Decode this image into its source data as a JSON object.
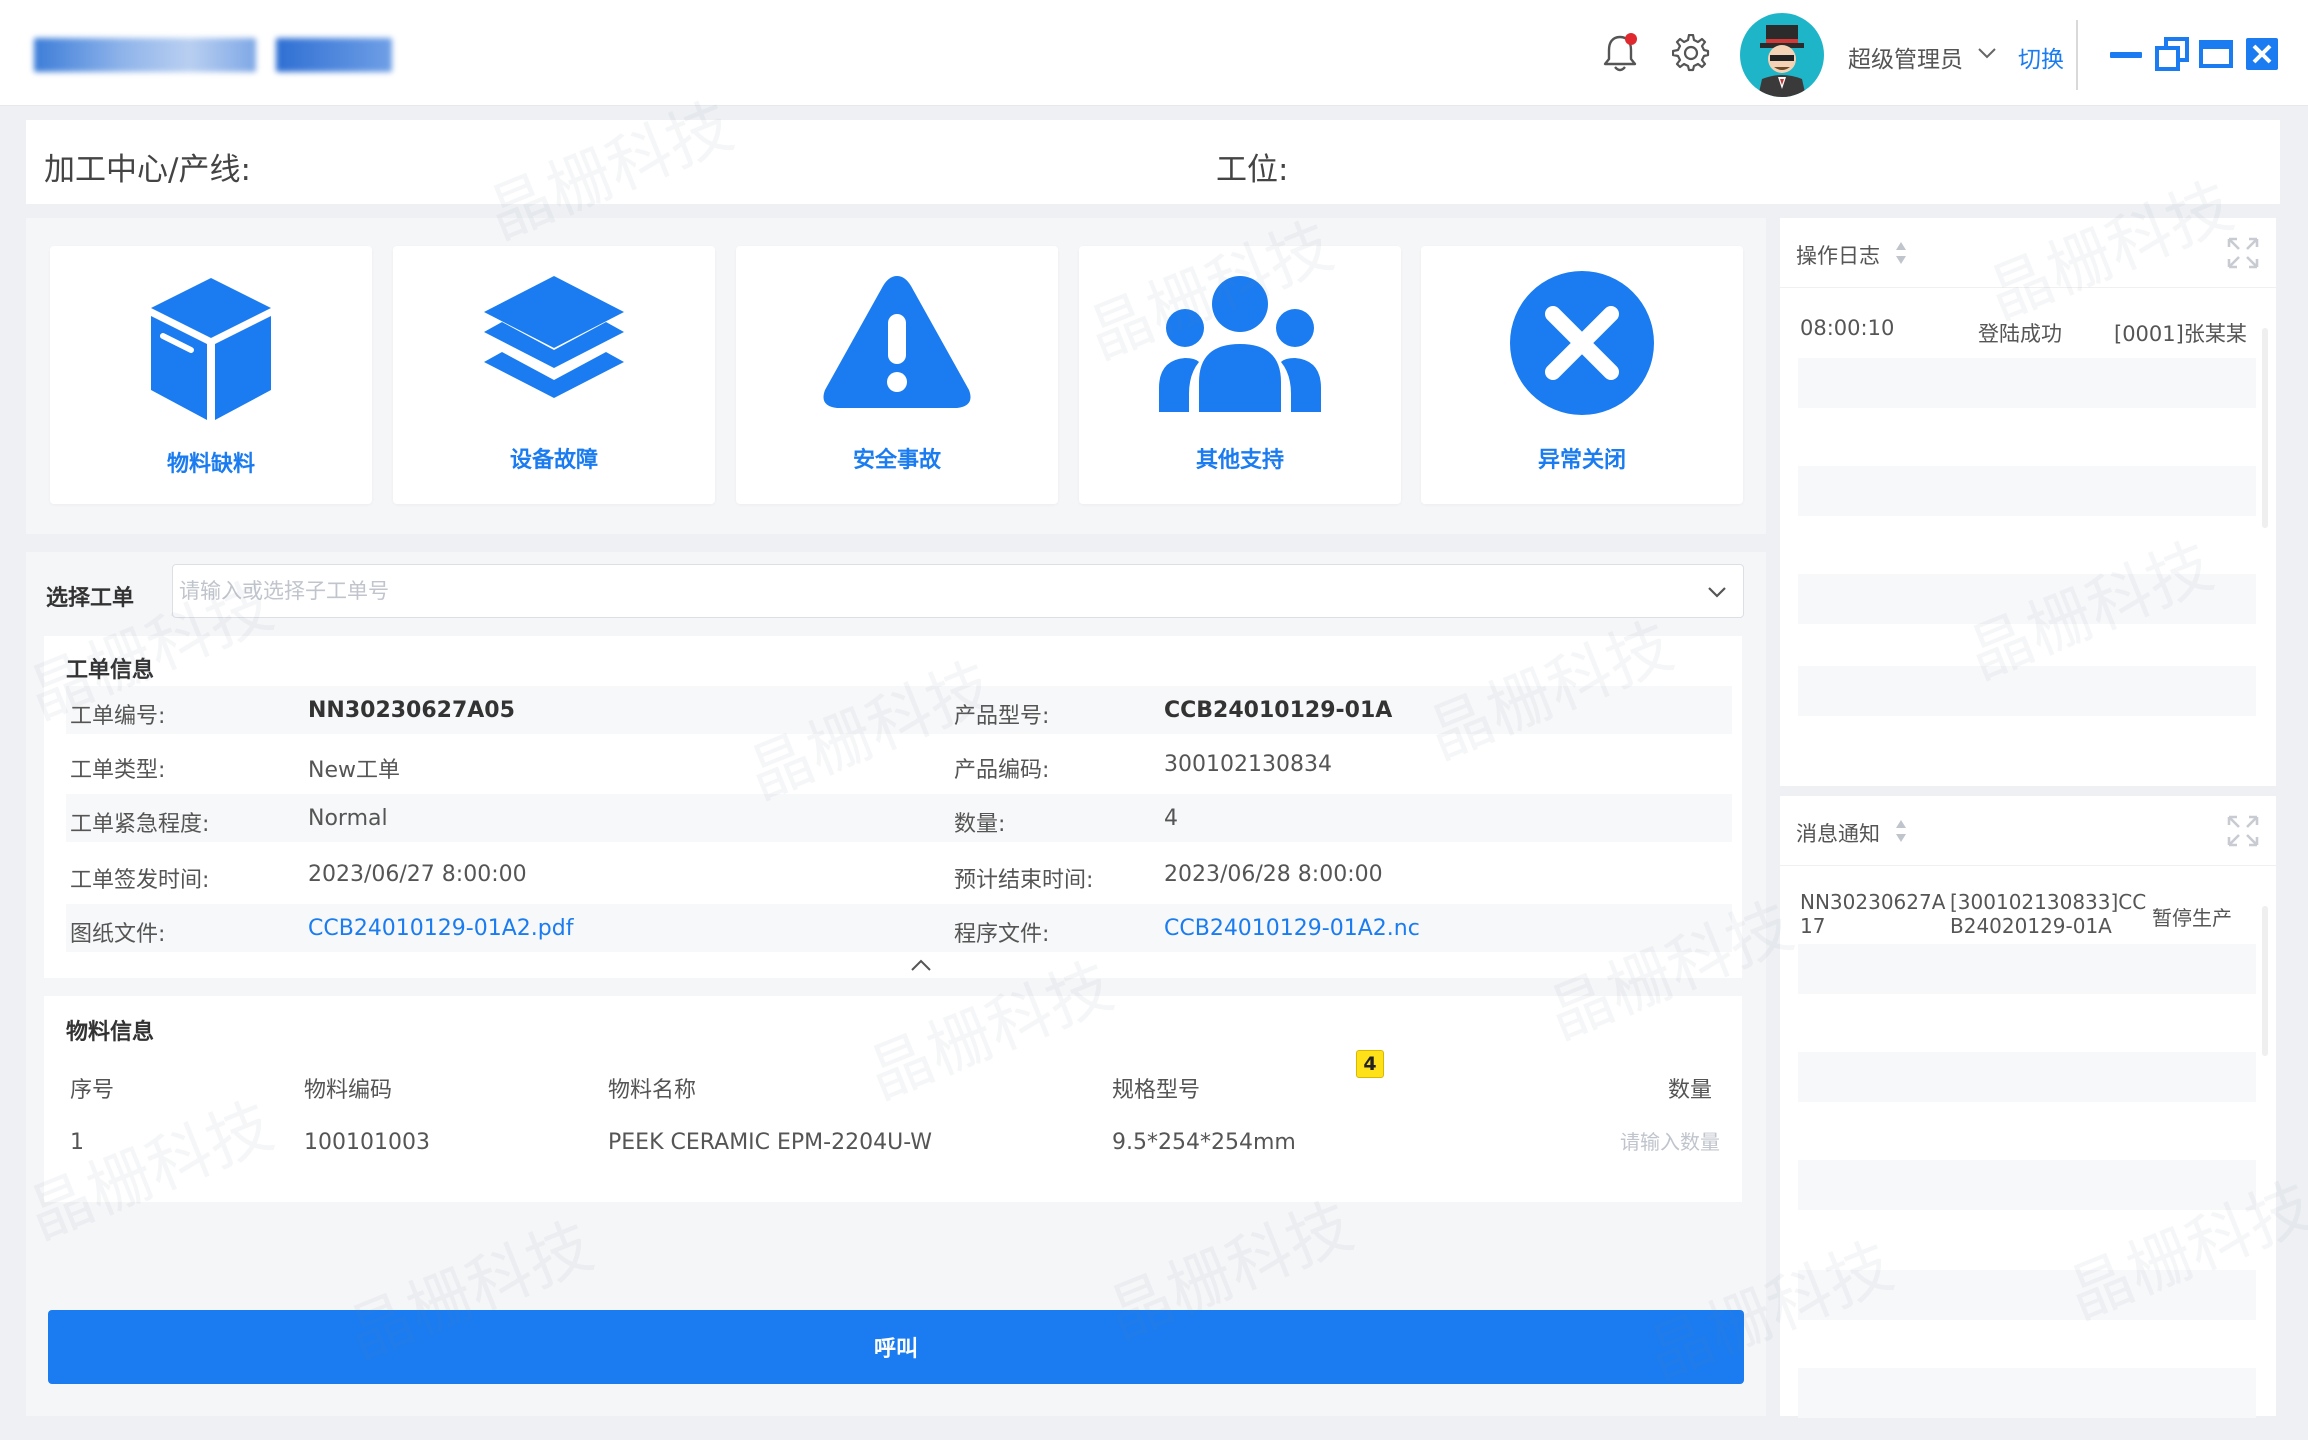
{
  "header": {
    "user_name": "超级管理员",
    "switch_label": "切换",
    "icons": [
      "bell-icon",
      "gear-icon",
      "chevron-down-icon",
      "minimize-icon",
      "restore-icon",
      "maximize-icon",
      "close-icon"
    ]
  },
  "line_bar": {
    "line_label": "加工中心/产线:",
    "station_label": "工位:"
  },
  "quick_actions": [
    {
      "label": "物料缺料",
      "icon": "box-icon"
    },
    {
      "label": "设备故障",
      "icon": "layers-icon"
    },
    {
      "label": "安全事故",
      "icon": "warning-icon"
    },
    {
      "label": "其他支持",
      "icon": "people-icon"
    },
    {
      "label": "异常关闭",
      "icon": "close-circle-icon"
    }
  ],
  "work_order": {
    "select_label": "选择工单",
    "select_placeholder": "请输入或选择子工单号",
    "info_title": "工单信息",
    "fields": {
      "order_no_label": "工单编号:",
      "order_no": "NN30230627A05",
      "product_model_label": "产品型号:",
      "product_model": "CCB24010129-01A",
      "order_type_label": "工单类型:",
      "order_type": "New工单",
      "product_code_label": "产品编码:",
      "product_code": "300102130834",
      "urgency_label": "工单紧急程度:",
      "urgency": "Normal",
      "quantity_label": "数量:",
      "quantity": "4",
      "issue_time_label": "工单签发时间:",
      "issue_time": "2023/06/27 8:00:00",
      "end_time_label": "预计结束时间:",
      "end_time": "2023/06/28 8:00:00",
      "drawing_label": "图纸文件:",
      "drawing_file": "CCB24010129-01A2.pdf",
      "program_label": "程序文件:",
      "program_file": "CCB24010129-01A2.nc"
    }
  },
  "materials": {
    "title": "物料信息",
    "columns": {
      "seq": "序号",
      "code": "物料编码",
      "name": "物料名称",
      "spec": "规格型号",
      "qty": "数量"
    },
    "badge": "4",
    "rows": [
      {
        "seq": "1",
        "code": "100101003",
        "name": "PEEK CERAMIC EPM-2204U-W",
        "spec": "9.5*254*254mm",
        "qty_placeholder": "请输入数量"
      }
    ]
  },
  "call_button": "呼叫",
  "log_panel": {
    "title": "操作日志",
    "rows": [
      {
        "time": "08:00:10",
        "action": "登陆成功",
        "user": "[0001]张某某"
      }
    ]
  },
  "msg_panel": {
    "title": "消息通知",
    "rows": [
      {
        "order_line1": "NN30230627A",
        "order_line2": "17",
        "product_line1": "[300102130833]CC",
        "product_line2": "B24020129-01A",
        "status": "暂停生产"
      }
    ]
  },
  "watermark": "晶栅科技",
  "colors": {
    "accent": "#1a7cf0",
    "badge": "#ffe11a",
    "avatar_bg": "#1fb5c9",
    "notify_dot": "#e0292f"
  }
}
